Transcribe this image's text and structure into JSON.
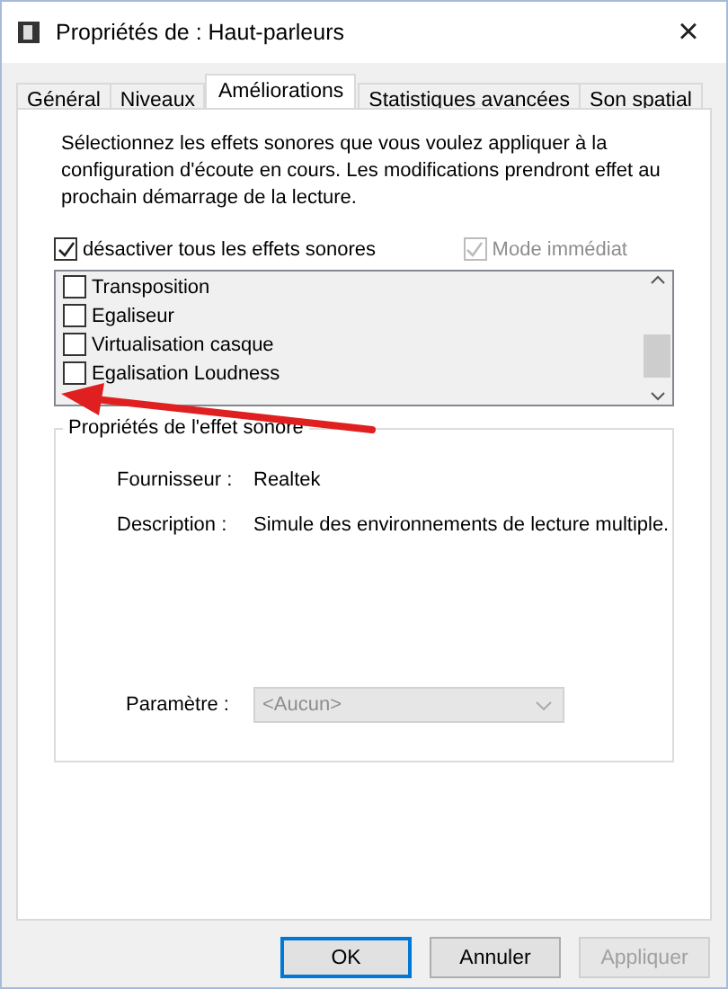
{
  "window": {
    "title": "Propriétés de : Haut-parleurs",
    "close": "×"
  },
  "tabs": [
    {
      "label": "Général",
      "selected": false
    },
    {
      "label": "Niveaux",
      "selected": false
    },
    {
      "label": "Améliorations",
      "selected": true
    },
    {
      "label": "Statistiques avancées",
      "selected": false
    },
    {
      "label": "Son spatial",
      "selected": false
    }
  ],
  "description": "Sélectionnez les effets sonores que vous voulez appliquer à la configuration d'écoute en cours. Les modifications prendront effet au prochain démarrage de la lecture.",
  "disable_all": {
    "label": "désactiver tous les effets sonores",
    "checked": true
  },
  "immediate_mode": {
    "label": "Mode immédiat",
    "checked": true,
    "disabled": true
  },
  "effects": [
    {
      "label": "Transposition",
      "checked": false
    },
    {
      "label": "Egaliseur",
      "checked": false
    },
    {
      "label": "Virtualisation casque",
      "checked": false
    },
    {
      "label": "Egalisation Loudness",
      "checked": false
    }
  ],
  "properties": {
    "title": "Propriétés de l'effet sonore",
    "fields": [
      {
        "label": "Fournisseur :",
        "value": "Realtek"
      },
      {
        "label": "Description :",
        "value": "Simule des environnements de lecture multiple."
      }
    ],
    "parameter": {
      "label": "Paramètre :",
      "value": "<Aucun>",
      "disabled": true
    }
  },
  "buttons": [
    {
      "label": "OK",
      "default": true,
      "disabled": false
    },
    {
      "label": "Annuler",
      "default": false,
      "disabled": false
    },
    {
      "label": "Appliquer",
      "default": false,
      "disabled": true
    }
  ]
}
